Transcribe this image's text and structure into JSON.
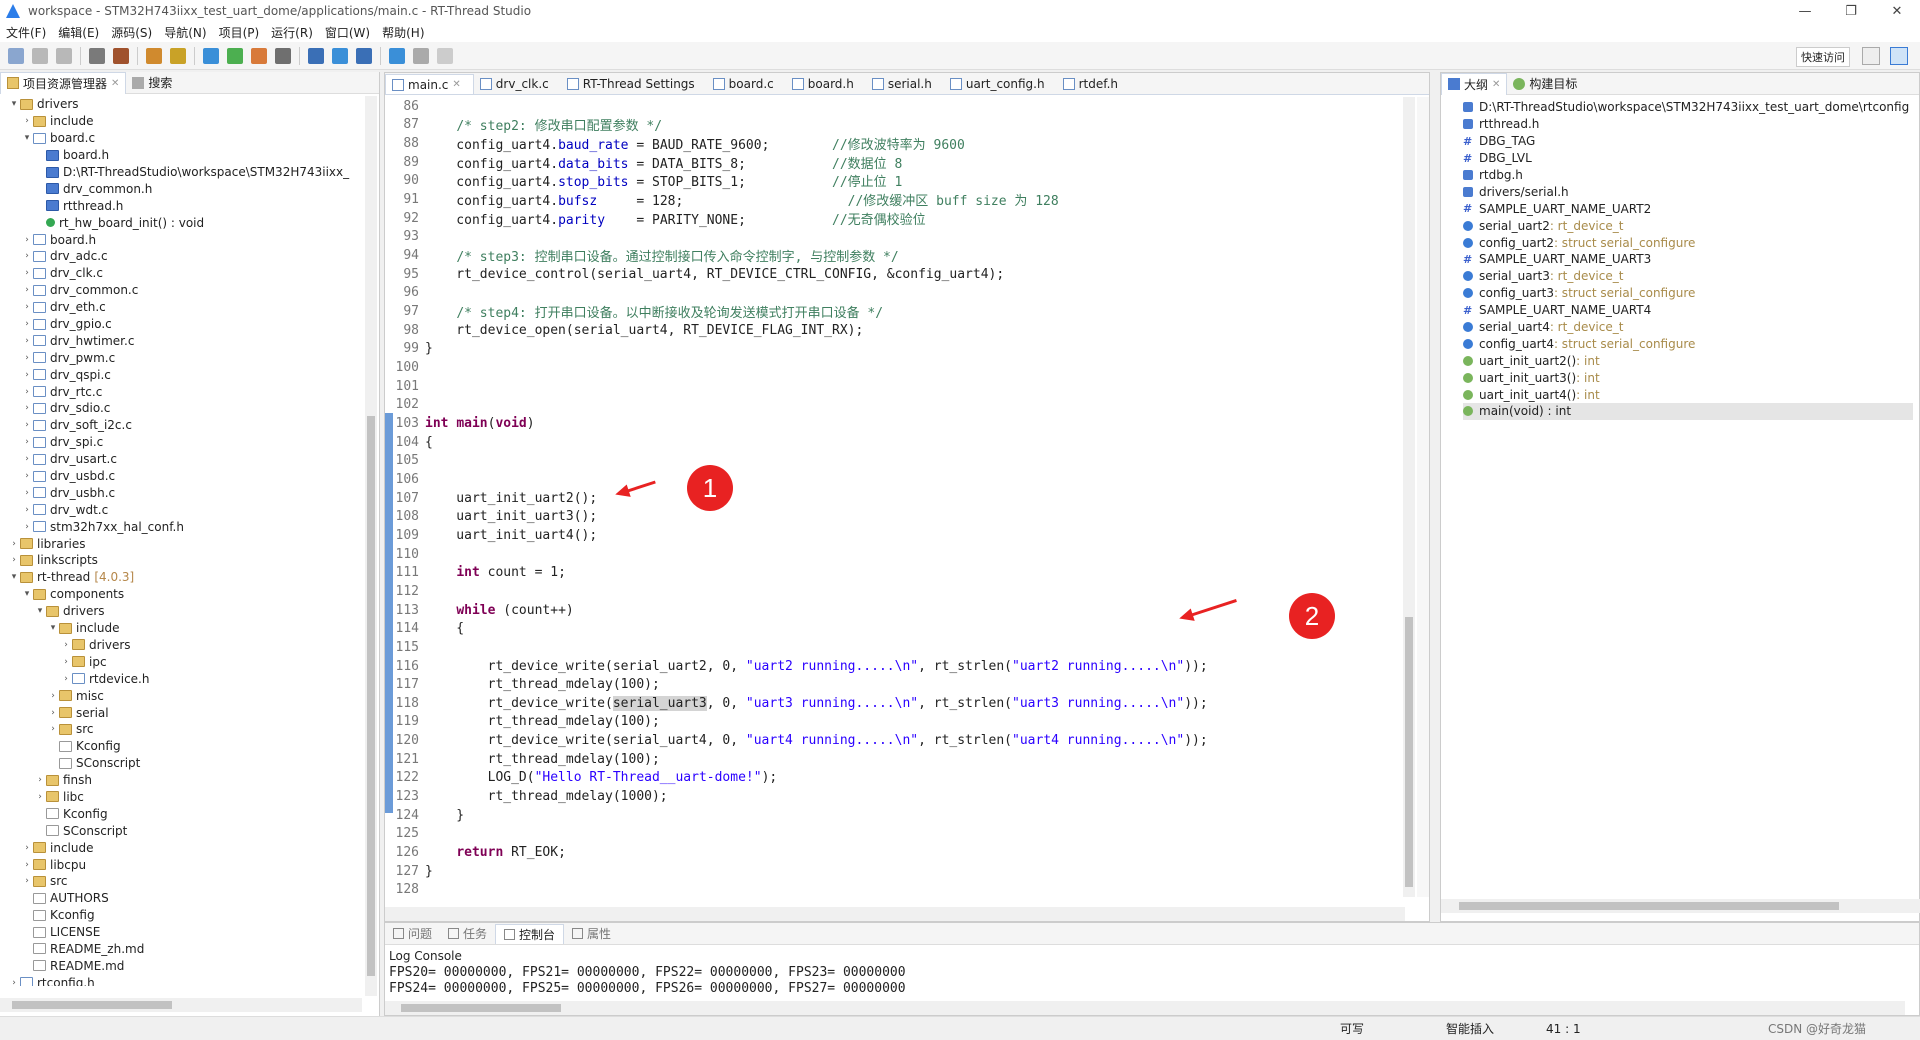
{
  "window": {
    "title": "workspace - STM32H743iixx_test_uart_dome/applications/main.c - RT-Thread Studio",
    "controls": [
      "—",
      "❐",
      "✕"
    ]
  },
  "menu": [
    "文件(F)",
    "编辑(E)",
    "源码(S)",
    "导航(N)",
    "项目(P)",
    "运行(R)",
    "窗口(W)",
    "帮助(H)"
  ],
  "toolbar": {
    "quick_access": "快速访问"
  },
  "left_panel": {
    "tabs": [
      {
        "label": "项目资源管理器"
      },
      {
        "label": "搜索"
      }
    ],
    "tree": [
      {
        "level": 1,
        "exp": "open",
        "icon": "folder",
        "label": "drivers"
      },
      {
        "level": 2,
        "exp": "closed",
        "icon": "folder",
        "label": "include"
      },
      {
        "level": 2,
        "exp": "open",
        "icon": "file-c",
        "label": "board.c"
      },
      {
        "level": 3,
        "exp": "",
        "icon": "inc",
        "label": "board.h"
      },
      {
        "level": 3,
        "exp": "",
        "icon": "inc",
        "label": "D:\\RT-ThreadStudio\\workspace\\STM32H743iixx_"
      },
      {
        "level": 3,
        "exp": "",
        "icon": "inc",
        "label": "drv_common.h"
      },
      {
        "level": 3,
        "exp": "",
        "icon": "inc",
        "label": "rtthread.h"
      },
      {
        "level": 3,
        "exp": "",
        "icon": "fn",
        "label": "rt_hw_board_init() : void"
      },
      {
        "level": 2,
        "exp": "closed",
        "icon": "file-h",
        "label": "board.h"
      },
      {
        "level": 2,
        "exp": "closed",
        "icon": "file-c",
        "label": "drv_adc.c"
      },
      {
        "level": 2,
        "exp": "closed",
        "icon": "file-c",
        "label": "drv_clk.c"
      },
      {
        "level": 2,
        "exp": "closed",
        "icon": "file-c",
        "label": "drv_common.c"
      },
      {
        "level": 2,
        "exp": "closed",
        "icon": "file-c",
        "label": "drv_eth.c"
      },
      {
        "level": 2,
        "exp": "closed",
        "icon": "file-c",
        "label": "drv_gpio.c"
      },
      {
        "level": 2,
        "exp": "closed",
        "icon": "file-c",
        "label": "drv_hwtimer.c"
      },
      {
        "level": 2,
        "exp": "closed",
        "icon": "file-c",
        "label": "drv_pwm.c"
      },
      {
        "level": 2,
        "exp": "closed",
        "icon": "file-c",
        "label": "drv_qspi.c"
      },
      {
        "level": 2,
        "exp": "closed",
        "icon": "file-c",
        "label": "drv_rtc.c"
      },
      {
        "level": 2,
        "exp": "closed",
        "icon": "file-c",
        "label": "drv_sdio.c"
      },
      {
        "level": 2,
        "exp": "closed",
        "icon": "file-c",
        "label": "drv_soft_i2c.c"
      },
      {
        "level": 2,
        "exp": "closed",
        "icon": "file-c",
        "label": "drv_spi.c"
      },
      {
        "level": 2,
        "exp": "closed",
        "icon": "file-c",
        "label": "drv_usart.c"
      },
      {
        "level": 2,
        "exp": "closed",
        "icon": "file-c",
        "label": "drv_usbd.c"
      },
      {
        "level": 2,
        "exp": "closed",
        "icon": "file-c",
        "label": "drv_usbh.c"
      },
      {
        "level": 2,
        "exp": "closed",
        "icon": "file-c",
        "label": "drv_wdt.c"
      },
      {
        "level": 2,
        "exp": "closed",
        "icon": "file-h",
        "label": "stm32h7xx_hal_conf.h"
      },
      {
        "level": 1,
        "exp": "closed",
        "icon": "folder",
        "label": "libraries"
      },
      {
        "level": 1,
        "exp": "closed",
        "icon": "folder",
        "label": "linkscripts"
      },
      {
        "level": 1,
        "exp": "open",
        "icon": "folder",
        "label": "rt-thread",
        "ver": "[4.0.3]"
      },
      {
        "level": 2,
        "exp": "open",
        "icon": "folder",
        "label": "components"
      },
      {
        "level": 3,
        "exp": "open",
        "icon": "folder",
        "label": "drivers"
      },
      {
        "level": 4,
        "exp": "open",
        "icon": "folder",
        "label": "include"
      },
      {
        "level": 5,
        "exp": "closed",
        "icon": "folder",
        "label": "drivers"
      },
      {
        "level": 5,
        "exp": "closed",
        "icon": "folder",
        "label": "ipc"
      },
      {
        "level": 5,
        "exp": "closed",
        "icon": "file-h",
        "label": "rtdevice.h"
      },
      {
        "level": 4,
        "exp": "closed",
        "icon": "folder",
        "label": "misc"
      },
      {
        "level": 4,
        "exp": "closed",
        "icon": "folder",
        "label": "serial"
      },
      {
        "level": 4,
        "exp": "closed",
        "icon": "folder",
        "label": "src"
      },
      {
        "level": 4,
        "exp": "",
        "icon": "file-t",
        "label": "Kconfig"
      },
      {
        "level": 4,
        "exp": "",
        "icon": "file-t",
        "label": "SConscript"
      },
      {
        "level": 3,
        "exp": "closed",
        "icon": "folder",
        "label": "finsh"
      },
      {
        "level": 3,
        "exp": "closed",
        "icon": "folder",
        "label": "libc"
      },
      {
        "level": 3,
        "exp": "",
        "icon": "file-t",
        "label": "Kconfig"
      },
      {
        "level": 3,
        "exp": "",
        "icon": "file-t",
        "label": "SConscript"
      },
      {
        "level": 2,
        "exp": "closed",
        "icon": "folder",
        "label": "include"
      },
      {
        "level": 2,
        "exp": "closed",
        "icon": "folder",
        "label": "libcpu"
      },
      {
        "level": 2,
        "exp": "closed",
        "icon": "folder",
        "label": "src"
      },
      {
        "level": 2,
        "exp": "",
        "icon": "file-t",
        "label": "AUTHORS"
      },
      {
        "level": 2,
        "exp": "",
        "icon": "file-t",
        "label": "Kconfig"
      },
      {
        "level": 2,
        "exp": "",
        "icon": "file-t",
        "label": "LICENSE"
      },
      {
        "level": 2,
        "exp": "",
        "icon": "file-t",
        "label": "README_zh.md"
      },
      {
        "level": 2,
        "exp": "",
        "icon": "file-t",
        "label": "README.md"
      },
      {
        "level": 1,
        "exp": "closed",
        "icon": "file-h",
        "label": "rtconfig.h"
      }
    ]
  },
  "editor": {
    "tabs": [
      {
        "label": "main.c",
        "active": true
      },
      {
        "label": "drv_clk.c"
      },
      {
        "label": "RT-Thread Settings"
      },
      {
        "label": "board.c"
      },
      {
        "label": "board.h"
      },
      {
        "label": "serial.h"
      },
      {
        "label": "uart_config.h"
      },
      {
        "label": "rtdef.h"
      }
    ],
    "lines": [
      {
        "n": "86",
        "segs": []
      },
      {
        "n": "87",
        "segs": [
          {
            "t": "    "
          },
          {
            "c": "cmt",
            "t": "/* step2: 修改串口配置参数 */"
          }
        ]
      },
      {
        "n": "88",
        "segs": [
          {
            "t": "    config_uart4."
          },
          {
            "c": "fld",
            "t": "baud_rate"
          },
          {
            "t": " = BAUD_RATE_9600;        "
          },
          {
            "c": "cmt",
            "t": "//修改波特率为 9600"
          }
        ]
      },
      {
        "n": "89",
        "segs": [
          {
            "t": "    config_uart4."
          },
          {
            "c": "fld",
            "t": "data_bits"
          },
          {
            "t": " = DATA_BITS_8;           "
          },
          {
            "c": "cmt",
            "t": "//数据位 8"
          }
        ]
      },
      {
        "n": "90",
        "segs": [
          {
            "t": "    config_uart4."
          },
          {
            "c": "fld",
            "t": "stop_bits"
          },
          {
            "t": " = STOP_BITS_1;           "
          },
          {
            "c": "cmt",
            "t": "//停止位 1"
          }
        ]
      },
      {
        "n": "91",
        "segs": [
          {
            "t": "    config_uart4."
          },
          {
            "c": "fld",
            "t": "bufsz"
          },
          {
            "t": "     = 128;                     "
          },
          {
            "c": "cmt",
            "t": "//修改缓冲区 buff size 为 128"
          }
        ]
      },
      {
        "n": "92",
        "segs": [
          {
            "t": "    config_uart4."
          },
          {
            "c": "fld",
            "t": "parity"
          },
          {
            "t": "    = PARITY_NONE;           "
          },
          {
            "c": "cmt",
            "t": "//无奇偶校验位"
          }
        ]
      },
      {
        "n": "93",
        "segs": []
      },
      {
        "n": "94",
        "segs": [
          {
            "t": "    "
          },
          {
            "c": "cmt",
            "t": "/* step3: 控制串口设备。通过控制接口传入命令控制字, 与控制参数 */"
          }
        ]
      },
      {
        "n": "95",
        "segs": [
          {
            "t": "    rt_device_control(serial_uart4, RT_DEVICE_CTRL_CONFIG, &config_uart4);"
          }
        ]
      },
      {
        "n": "96",
        "segs": []
      },
      {
        "n": "97",
        "segs": [
          {
            "t": "    "
          },
          {
            "c": "cmt",
            "t": "/* step4: 打开串口设备。以中断接收及轮询发送模式打开串口设备 */"
          }
        ]
      },
      {
        "n": "98",
        "segs": [
          {
            "t": "    rt_device_open(serial_uart4, RT_DEVICE_FLAG_INT_RX);"
          }
        ]
      },
      {
        "n": "99",
        "segs": [
          {
            "t": "}"
          }
        ]
      },
      {
        "n": "100",
        "segs": []
      },
      {
        "n": "101",
        "segs": []
      },
      {
        "n": "102",
        "segs": []
      },
      {
        "n": "103",
        "segs": [
          {
            "c": "kw",
            "t": "int"
          },
          {
            "t": " "
          },
          {
            "c": "kw",
            "t": "main"
          },
          {
            "t": "("
          },
          {
            "c": "kw",
            "t": "void"
          },
          {
            "t": ")"
          }
        ]
      },
      {
        "n": "104",
        "segs": [
          {
            "t": "{"
          }
        ]
      },
      {
        "n": "105",
        "segs": []
      },
      {
        "n": "106",
        "segs": []
      },
      {
        "n": "107",
        "segs": [
          {
            "t": "    uart_init_uart2();"
          }
        ]
      },
      {
        "n": "108",
        "segs": [
          {
            "t": "    uart_init_uart3();"
          }
        ]
      },
      {
        "n": "109",
        "segs": [
          {
            "t": "    uart_init_uart4();"
          }
        ]
      },
      {
        "n": "110",
        "segs": []
      },
      {
        "n": "111",
        "segs": [
          {
            "t": "    "
          },
          {
            "c": "kw",
            "t": "int"
          },
          {
            "t": " count = 1;"
          }
        ]
      },
      {
        "n": "112",
        "segs": []
      },
      {
        "n": "113",
        "segs": [
          {
            "t": "    "
          },
          {
            "c": "kw",
            "t": "while"
          },
          {
            "t": " (count++)"
          }
        ]
      },
      {
        "n": "114",
        "segs": [
          {
            "t": "    {"
          }
        ]
      },
      {
        "n": "115",
        "segs": []
      },
      {
        "n": "116",
        "segs": [
          {
            "t": "        rt_device_write(serial_uart2, 0, "
          },
          {
            "c": "str",
            "t": "\"uart2 running.....\\n\""
          },
          {
            "t": ", rt_strlen("
          },
          {
            "c": "str",
            "t": "\"uart2 running.....\\n\""
          },
          {
            "t": "));"
          }
        ]
      },
      {
        "n": "117",
        "segs": [
          {
            "t": "        rt_thread_mdelay(100);"
          }
        ]
      },
      {
        "n": "118",
        "segs": [
          {
            "t": "        rt_device_write("
          },
          {
            "c": "sel",
            "t": "serial_uart3"
          },
          {
            "t": ", 0, "
          },
          {
            "c": "str",
            "t": "\"uart3 running.....\\n\""
          },
          {
            "t": ", rt_strlen("
          },
          {
            "c": "str",
            "t": "\"uart3 running.....\\n\""
          },
          {
            "t": "));"
          }
        ]
      },
      {
        "n": "119",
        "segs": [
          {
            "t": "        rt_thread_mdelay(100);"
          }
        ]
      },
      {
        "n": "120",
        "segs": [
          {
            "t": "        rt_device_write(serial_uart4, 0, "
          },
          {
            "c": "str",
            "t": "\"uart4 running.....\\n\""
          },
          {
            "t": ", rt_strlen("
          },
          {
            "c": "str",
            "t": "\"uart4 running.....\\n\""
          },
          {
            "t": "));"
          }
        ]
      },
      {
        "n": "121",
        "segs": [
          {
            "t": "        rt_thread_mdelay(100);"
          }
        ]
      },
      {
        "n": "122",
        "segs": [
          {
            "t": "        LOG_D("
          },
          {
            "c": "str",
            "t": "\"Hello RT-Thread__uart-dome!\""
          },
          {
            "t": ");"
          }
        ]
      },
      {
        "n": "123",
        "segs": [
          {
            "t": "        rt_thread_mdelay(1000);"
          }
        ]
      },
      {
        "n": "124",
        "segs": [
          {
            "t": "    }"
          }
        ]
      },
      {
        "n": "125",
        "segs": []
      },
      {
        "n": "126",
        "segs": [
          {
            "t": "    "
          },
          {
            "c": "kw",
            "t": "return"
          },
          {
            "t": " RT_EOK;"
          }
        ]
      },
      {
        "n": "127",
        "segs": [
          {
            "t": "}"
          }
        ]
      },
      {
        "n": "128",
        "segs": []
      }
    ],
    "annotations": [
      "1",
      "2"
    ]
  },
  "outline": {
    "tabs": [
      {
        "label": "大纲"
      },
      {
        "label": "构建目标"
      }
    ],
    "items": [
      {
        "icon": "inc",
        "label": "D:\\RT-ThreadStudio\\workspace\\STM32H743iixx_test_uart_dome\\rtconfig"
      },
      {
        "icon": "inc",
        "label": "rtthread.h"
      },
      {
        "icon": "def",
        "label": "DBG_TAG"
      },
      {
        "icon": "def",
        "label": "DBG_LVL"
      },
      {
        "icon": "inc",
        "label": "rtdbg.h"
      },
      {
        "icon": "inc",
        "label": "drivers/serial.h"
      },
      {
        "icon": "def",
        "label": "SAMPLE_UART_NAME_UART2"
      },
      {
        "icon": "var",
        "label": "serial_uart2",
        "type": " : rt_device_t"
      },
      {
        "icon": "var",
        "label": "config_uart2",
        "type": " : struct serial_configure"
      },
      {
        "icon": "def",
        "label": "SAMPLE_UART_NAME_UART3"
      },
      {
        "icon": "var",
        "label": "serial_uart3",
        "type": " : rt_device_t"
      },
      {
        "icon": "var",
        "label": "config_uart3",
        "type": " : struct serial_configure"
      },
      {
        "icon": "def",
        "label": "SAMPLE_UART_NAME_UART4"
      },
      {
        "icon": "var",
        "label": "serial_uart4",
        "type": " : rt_device_t"
      },
      {
        "icon": "var",
        "label": "config_uart4",
        "type": " : struct serial_configure"
      },
      {
        "icon": "fn",
        "label": "uart_init_uart2()",
        "type": " : int"
      },
      {
        "icon": "fn",
        "label": "uart_init_uart3()",
        "type": " : int"
      },
      {
        "icon": "fn",
        "label": "uart_init_uart4()",
        "type": " : int"
      },
      {
        "icon": "fn",
        "label": "main(void) : int",
        "type": "",
        "selected": true
      }
    ]
  },
  "console": {
    "tabs": [
      {
        "label": "问题"
      },
      {
        "label": "任务"
      },
      {
        "label": "控制台",
        "active": true
      },
      {
        "label": "属性"
      }
    ],
    "title": "Log Console",
    "lines": [
      "FPS20= 00000000, FPS21= 00000000, FPS22= 00000000, FPS23= 00000000",
      "FPS24= 00000000, FPS25= 00000000, FPS26= 00000000, FPS27= 00000000"
    ]
  },
  "status": {
    "writable": "可写",
    "insert_mode": "智能插入",
    "position": "41 : 1",
    "watermark": "CSDN @好奇龙猫"
  },
  "colors": {
    "accent": "#2b7de9",
    "annotation": "#e82222",
    "keyword": "#7f0055",
    "string": "#2a00ff",
    "comment": "#3f7f5f",
    "field": "#0000c0"
  }
}
